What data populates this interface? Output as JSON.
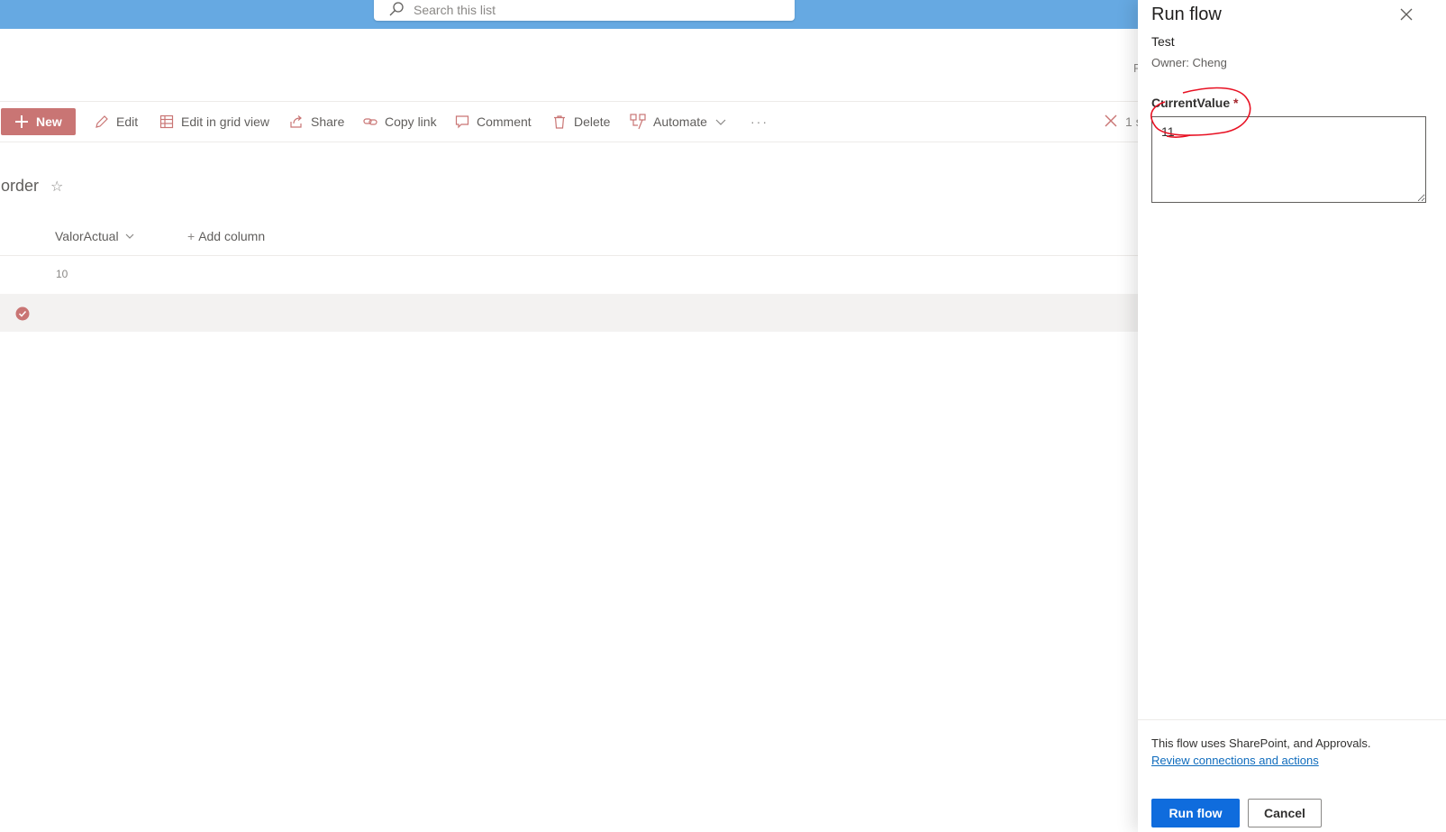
{
  "search": {
    "placeholder": "Search this list",
    "icon": "search-icon"
  },
  "header": {
    "fragment": "P"
  },
  "toolbar": {
    "new_label": "New",
    "edit_label": "Edit",
    "grid_label": "Edit in grid view",
    "share_label": "Share",
    "copy_label": "Copy link",
    "comment_label": "Comment",
    "delete_label": "Delete",
    "automate_label": "Automate",
    "more_label": "···",
    "selection_count": "1 s"
  },
  "list": {
    "title": "order",
    "star": "☆",
    "columns": [
      "ValorActual",
      "Add column"
    ],
    "add_column_prefix": "+",
    "rows": [
      {
        "ValorActual": "10"
      },
      {
        "ValorActual": ""
      }
    ]
  },
  "panel": {
    "title": "Run flow",
    "flow_name": "Test",
    "owner": "Owner: Cheng",
    "field_label": "CurrentValue",
    "required_mark": "*",
    "field_value": "11",
    "uses_text": "This flow uses SharePoint, and Approvals.",
    "review_link": "Review connections and actions",
    "run_label": "Run flow",
    "cancel_label": "Cancel"
  },
  "colors": {
    "suite_bar": "#66a9e2",
    "new_button": "#c97574",
    "accent_icon": "#c97574",
    "primary_button": "#0f6cdd",
    "annotation": "#e81123"
  }
}
